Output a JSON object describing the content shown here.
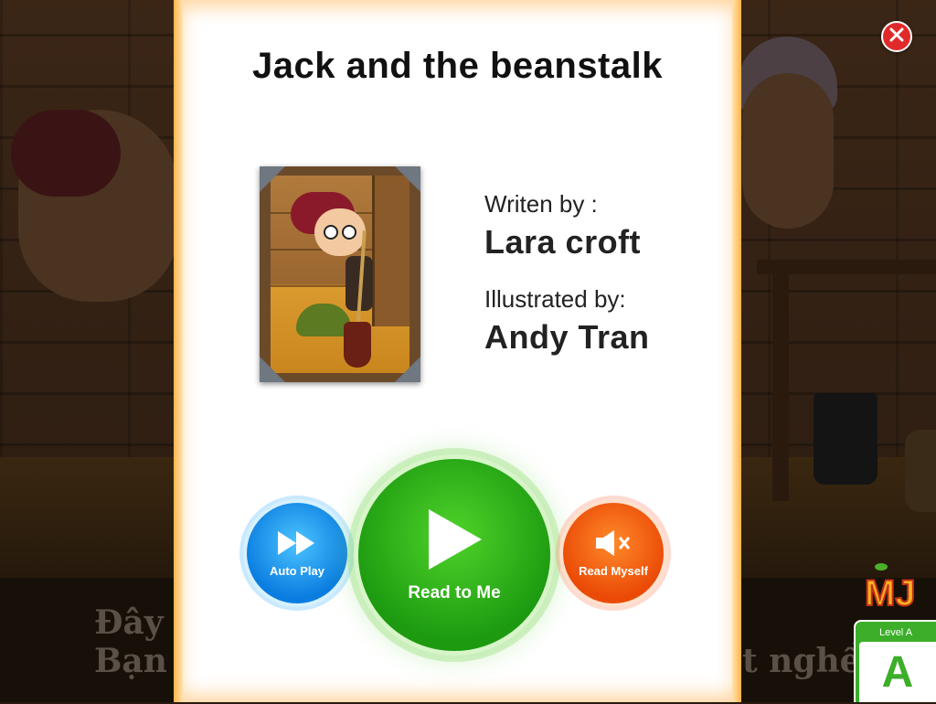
{
  "story": {
    "title": "Jack and the beanstalk"
  },
  "credits": {
    "written_label": "Writen by :",
    "author": "Lara croft",
    "illustrated_label": "Illustrated by:",
    "illustrator": "Andy Tran"
  },
  "actions": {
    "auto_play_label": "Auto Play",
    "read_to_me_label": "Read to Me",
    "read_myself_label": "Read Myself"
  },
  "level": {
    "label": "Level A",
    "letter": "A"
  },
  "logo": {
    "text": "MJ"
  },
  "background_text": {
    "line1_left": "Đây",
    "line2_left": "Bạn",
    "line2_right": "t nghề"
  },
  "icons": {
    "close": "close-icon",
    "auto_play": "fast-forward-icon",
    "read_to_me": "play-icon",
    "read_myself": "mute-icon"
  },
  "colors": {
    "auto_play": "#0a7de0",
    "read_to_me": "#1d9a10",
    "read_myself": "#ea4a06",
    "close": "#e02a2a",
    "level": "#3cae2a",
    "modal_glow": "#ffb347"
  }
}
